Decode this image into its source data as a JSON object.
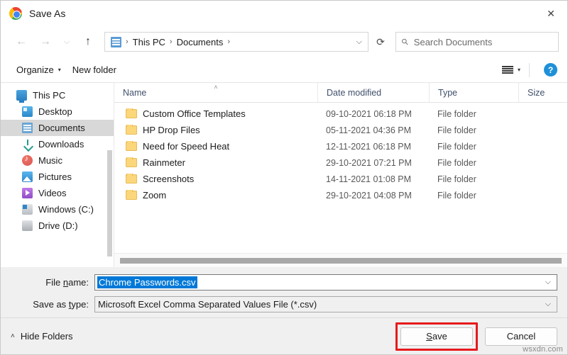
{
  "titlebar": {
    "title": "Save As",
    "app_icon": "chrome-logo-icon",
    "close_label": "✕"
  },
  "nav": {
    "back": "←",
    "forward": "→",
    "recent": "⌵",
    "up": "↑",
    "refresh": "⟳",
    "address_chevron": "⌵",
    "breadcrumbs": [
      {
        "label": "This PC",
        "sep": "›"
      },
      {
        "label": "Documents",
        "sep": "›"
      }
    ],
    "folder_icon": "documents-folder-icon"
  },
  "search": {
    "placeholder": "Search Documents",
    "icon": "search-icon"
  },
  "toolbar": {
    "organize_label": "Organize",
    "organize_caret": "▾",
    "new_folder_label": "New folder",
    "view_icon": "list-view-icon",
    "view_caret": "▾",
    "help_label": "?"
  },
  "sidebar": {
    "items": [
      {
        "label": "This PC",
        "icon": "this-pc-icon",
        "name": "this-pc",
        "indent": false,
        "selected": false
      },
      {
        "label": "Desktop",
        "icon": "desktop-icon",
        "name": "desktop",
        "indent": true,
        "selected": false
      },
      {
        "label": "Documents",
        "icon": "documents-icon",
        "name": "documents",
        "indent": true,
        "selected": true
      },
      {
        "label": "Downloads",
        "icon": "downloads-icon",
        "name": "downloads",
        "indent": true,
        "selected": false
      },
      {
        "label": "Music",
        "icon": "music-icon",
        "name": "music",
        "indent": true,
        "selected": false
      },
      {
        "label": "Pictures",
        "icon": "pictures-icon",
        "name": "pictures",
        "indent": true,
        "selected": false
      },
      {
        "label": "Videos",
        "icon": "videos-icon",
        "name": "videos",
        "indent": true,
        "selected": false
      },
      {
        "label": "Windows (C:)",
        "icon": "drive-c-icon",
        "name": "windows-c",
        "indent": true,
        "selected": false
      },
      {
        "label": "Drive (D:)",
        "icon": "drive-d-icon",
        "name": "drive-d",
        "indent": true,
        "selected": false
      }
    ]
  },
  "filelist": {
    "columns": {
      "name": "Name",
      "date_modified": "Date modified",
      "type": "Type",
      "size": "Size"
    },
    "sort_indicator": "˄",
    "rows": [
      {
        "name": "Custom Office Templates",
        "date": "09-10-2021 06:18 PM",
        "type": "File folder",
        "size": ""
      },
      {
        "name": "HP Drop Files",
        "date": "05-11-2021 04:36 PM",
        "type": "File folder",
        "size": ""
      },
      {
        "name": "Need for Speed Heat",
        "date": "12-11-2021 06:18 PM",
        "type": "File folder",
        "size": ""
      },
      {
        "name": "Rainmeter",
        "date": "29-10-2021 07:21 PM",
        "type": "File folder",
        "size": ""
      },
      {
        "name": "Screenshots",
        "date": "14-11-2021 01:08 PM",
        "type": "File folder",
        "size": ""
      },
      {
        "name": "Zoom",
        "date": "29-10-2021 04:08 PM",
        "type": "File folder",
        "size": ""
      }
    ]
  },
  "fields": {
    "file_name_label": "File name:",
    "file_name_value": "Chrome Passwords.csv",
    "save_type_label": "Save as type:",
    "save_type_value": "Microsoft Excel Comma Separated Values File (*.csv)",
    "chevron": "⌵"
  },
  "footer": {
    "hide_folders_label": "Hide Folders",
    "hide_folders_chevron": "˄",
    "save_label": "Save",
    "cancel_label": "Cancel"
  },
  "watermark": "wsxdn.com",
  "colors": {
    "selection_blue": "#0078d7",
    "highlight_red": "#e8191c",
    "help_blue": "#1e90d8",
    "folder_yellow": "#fcd67a"
  }
}
